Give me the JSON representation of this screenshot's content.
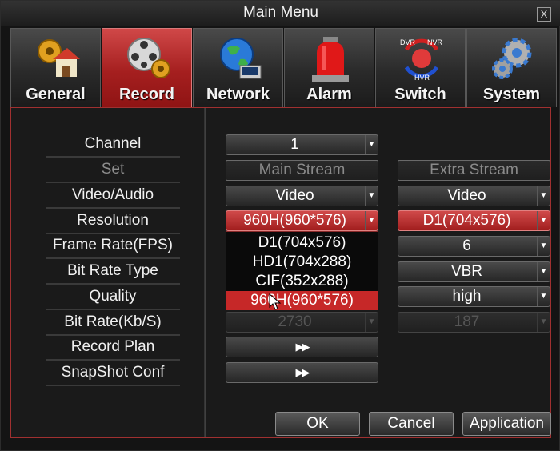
{
  "window": {
    "title": "Main Menu",
    "close_label": "X"
  },
  "tabs": [
    {
      "label": "General",
      "icon": "general-icon",
      "active": false
    },
    {
      "label": "Record",
      "icon": "record-icon",
      "active": true
    },
    {
      "label": "Network",
      "icon": "network-icon",
      "active": false
    },
    {
      "label": "Alarm",
      "icon": "alarm-icon",
      "active": false
    },
    {
      "label": "Switch",
      "icon": "switch-icon",
      "active": false,
      "icon_text": {
        "dvr": "DVR",
        "nvr": "NVR",
        "hvr": "HVR"
      }
    },
    {
      "label": "System",
      "icon": "system-icon",
      "active": false
    }
  ],
  "labels": {
    "channel": "Channel",
    "set": "Set",
    "video_audio": "Video/Audio",
    "resolution": "Resolution",
    "frame_rate": "Frame Rate(FPS)",
    "bit_rate_type": "Bit Rate Type",
    "quality": "Quality",
    "bit_rate": "Bit Rate(Kb/S)",
    "record_plan": "Record Plan",
    "snapshot_conf": "SnapShot Conf"
  },
  "main_stream": {
    "header": "Main Stream",
    "channel": "1",
    "video_audio": "Video",
    "resolution": "960H(960*576)",
    "bit_rate": "2730"
  },
  "extra_stream": {
    "header": "Extra Stream",
    "video_audio": "Video",
    "resolution": "D1(704x576)",
    "frame_rate": "6",
    "bit_rate_type": "VBR",
    "quality": "high",
    "bit_rate": "187"
  },
  "resolution_options": [
    "D1(704x576)",
    "HD1(704x288)",
    "CIF(352x288)",
    "960H(960*576)"
  ],
  "resolution_selected_index": 3,
  "play_label": "▶▶",
  "buttons": {
    "ok": "OK",
    "cancel": "Cancel",
    "apply": "Application"
  },
  "colors": {
    "accent_red": "#c62828",
    "background": "#141414"
  }
}
